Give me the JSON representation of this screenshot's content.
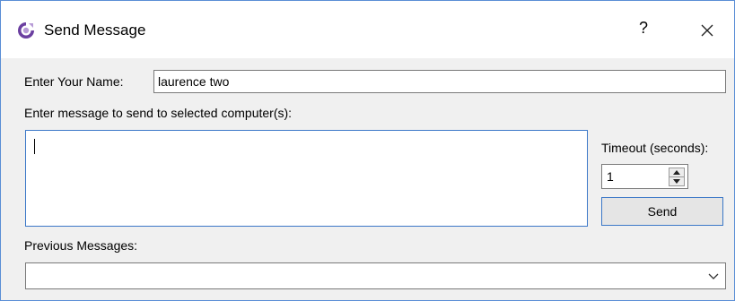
{
  "window": {
    "title": "Send Message",
    "help_label": "?"
  },
  "form": {
    "name_label": "Enter Your Name:",
    "name_value": "laurence two",
    "message_label": "Enter message to send to selected computer(s):",
    "message_value": "",
    "timeout_label": "Timeout (seconds):",
    "timeout_value": "1",
    "send_label": "Send",
    "previous_label": "Previous Messages:",
    "previous_value": ""
  },
  "colors": {
    "accent": "#3c78c8",
    "dialog_bg": "#f0f0f0",
    "app_icon": "#6b3fa0"
  },
  "icons": [
    "app-icon",
    "close-icon",
    "spin-up-icon",
    "spin-down-icon",
    "chevron-down-icon"
  ]
}
